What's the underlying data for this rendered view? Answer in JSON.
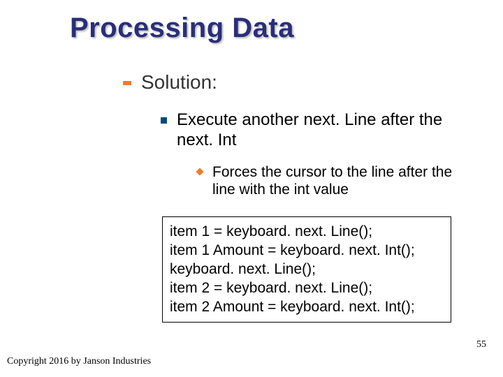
{
  "title": "Processing Data",
  "bullets": {
    "level1": "Solution:",
    "level2": "Execute another next. Line after the next. Int",
    "level3": "Forces the cursor to the line after the line with the int value"
  },
  "code": [
    "item 1 = keyboard. next. Line();",
    "item 1 Amount = keyboard. next. Int();",
    "keyboard. next. Line();",
    "item 2 = keyboard. next. Line();",
    "item 2 Amount = keyboard. next. Int();"
  ],
  "footer": "Copyright 2016 by Janson Industries",
  "page_number": "55"
}
